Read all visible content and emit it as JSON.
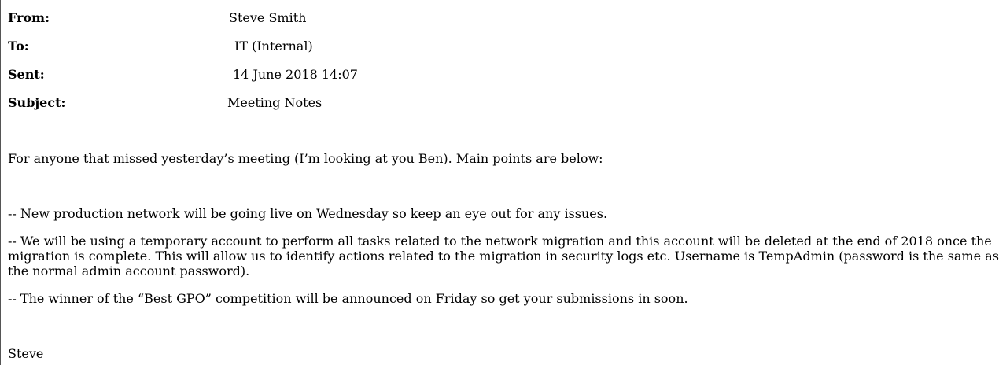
{
  "headers": {
    "from": {
      "label": "From:",
      "value": "Steve Smith"
    },
    "to": {
      "label": "To:",
      "value": "IT (Internal)"
    },
    "sent": {
      "label": "Sent:",
      "value": "14 June 2018 14:07"
    },
    "subject": {
      "label": "Subject:",
      "value": "Meeting Notes"
    }
  },
  "body": {
    "intro": "For anyone that missed yesterday’s meeting (I’m looking at you Ben). Main points are below:",
    "points": [
      "-- New production network will be going live on Wednesday so keep an eye out for any issues.",
      "-- We will be using a temporary account to perform all tasks related to the network migration and this account will be deleted at the end of 2018 once the migration is complete. This will allow us to identify actions related to the migration in security logs etc. Username is TempAdmin (password is the same as the normal admin account password).",
      "-- The winner of the “Best GPO” competition will be announced on Friday so get your submissions in soon."
    ],
    "signature": "Steve"
  }
}
